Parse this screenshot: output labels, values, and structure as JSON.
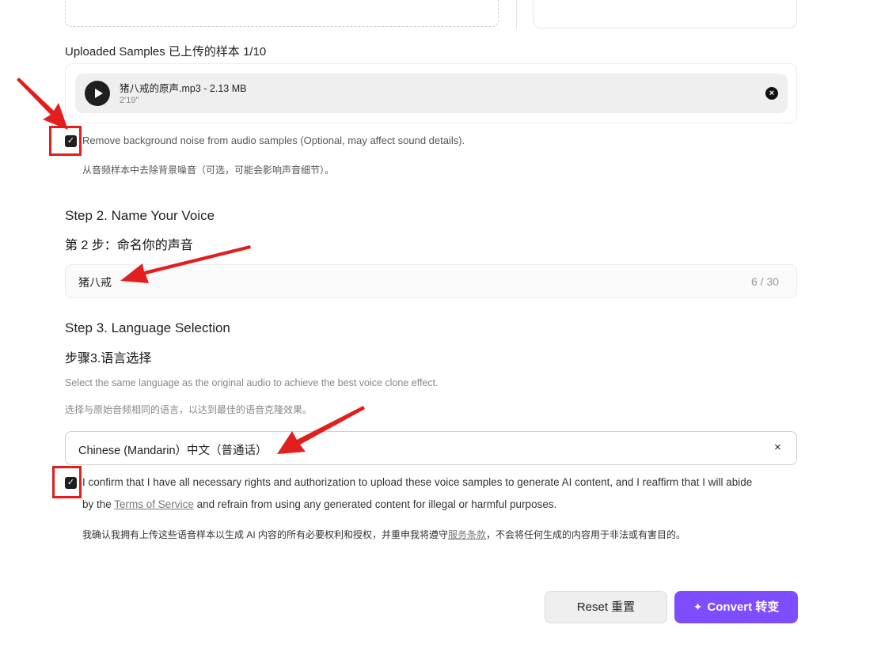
{
  "upload": {
    "samples_label": "Uploaded Samples  已上传的样本  1/10",
    "sample": {
      "name": "猪八戒的原声.mp3 - 2.13 MB",
      "duration": "2'19\""
    },
    "remove_icon": "close-icon"
  },
  "noise": {
    "label": "Remove background noise from audio samples (Optional, may affect sound details).",
    "label_cn": "从音频样本中去除背景噪音（可选，可能会影响声音细节）。",
    "checked": true
  },
  "step2": {
    "title": "Step 2. Name Your Voice",
    "title_cn": "第 2 步：命名你的声音",
    "name_value": "猪八戒",
    "char_count": "6 / 30"
  },
  "step3": {
    "title": "Step 3. Language Selection",
    "title_cn": "步骤3.语言选择",
    "hint": "Select the same language as the original audio to achieve the best voice clone effect.",
    "hint_cn": "选择与原始音频相同的语言，以达到最佳的语音克隆效果。",
    "selected_language": "Chinese (Mandarin）中文（普通话）",
    "clear_icon": "×"
  },
  "consent": {
    "line1": "I confirm that I have all necessary rights and authorization to upload these voice samples to generate AI content, and I reaffirm that I will abide",
    "line2_prefix": "by the ",
    "tos_link": "Terms of Service",
    "line2_suffix": " and refrain from using any generated content for illegal or harmful purposes.",
    "cn_prefix": "我确认我拥有上传这些语音样本以生成 AI 内容的所有必要权利和授权，并重申我将遵守",
    "cn_link": "服务条款",
    "cn_suffix": "，不会将任何生成的内容用于非法或有害目的。",
    "checked": true
  },
  "actions": {
    "reset": "Reset  重置",
    "convert": "Convert  转变",
    "convert_icon": "✦"
  },
  "colors": {
    "accent": "#7d4dff",
    "annotation": "#e21e1e"
  }
}
